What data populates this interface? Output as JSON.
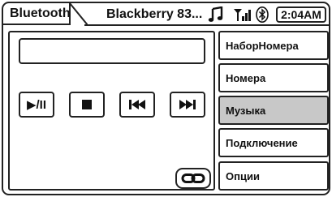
{
  "header": {
    "tab_label": "Bluetooth",
    "device_name": "Blackberry 83...",
    "clock": "2:04AM",
    "icons": [
      "music-note-icon",
      "signal-strength-icon",
      "bluetooth-icon"
    ]
  },
  "player": {
    "track_text": "",
    "controls": {
      "play_pause_label": "▶/II",
      "stop_icon": "stop-icon",
      "previous_icon": "previous-track-icon",
      "next_icon": "next-track-icon"
    },
    "link_icon": "link-icon"
  },
  "menu": {
    "items": [
      {
        "label": "НаборНомера",
        "active": false
      },
      {
        "label": "Номера",
        "active": false
      },
      {
        "label": "Музыка",
        "active": true
      },
      {
        "label": "Подключение",
        "active": false
      },
      {
        "label": "Опции",
        "active": false
      }
    ]
  },
  "colors": {
    "border": "#222222",
    "active_item": "#c8c8c8",
    "background": "#ffffff"
  }
}
